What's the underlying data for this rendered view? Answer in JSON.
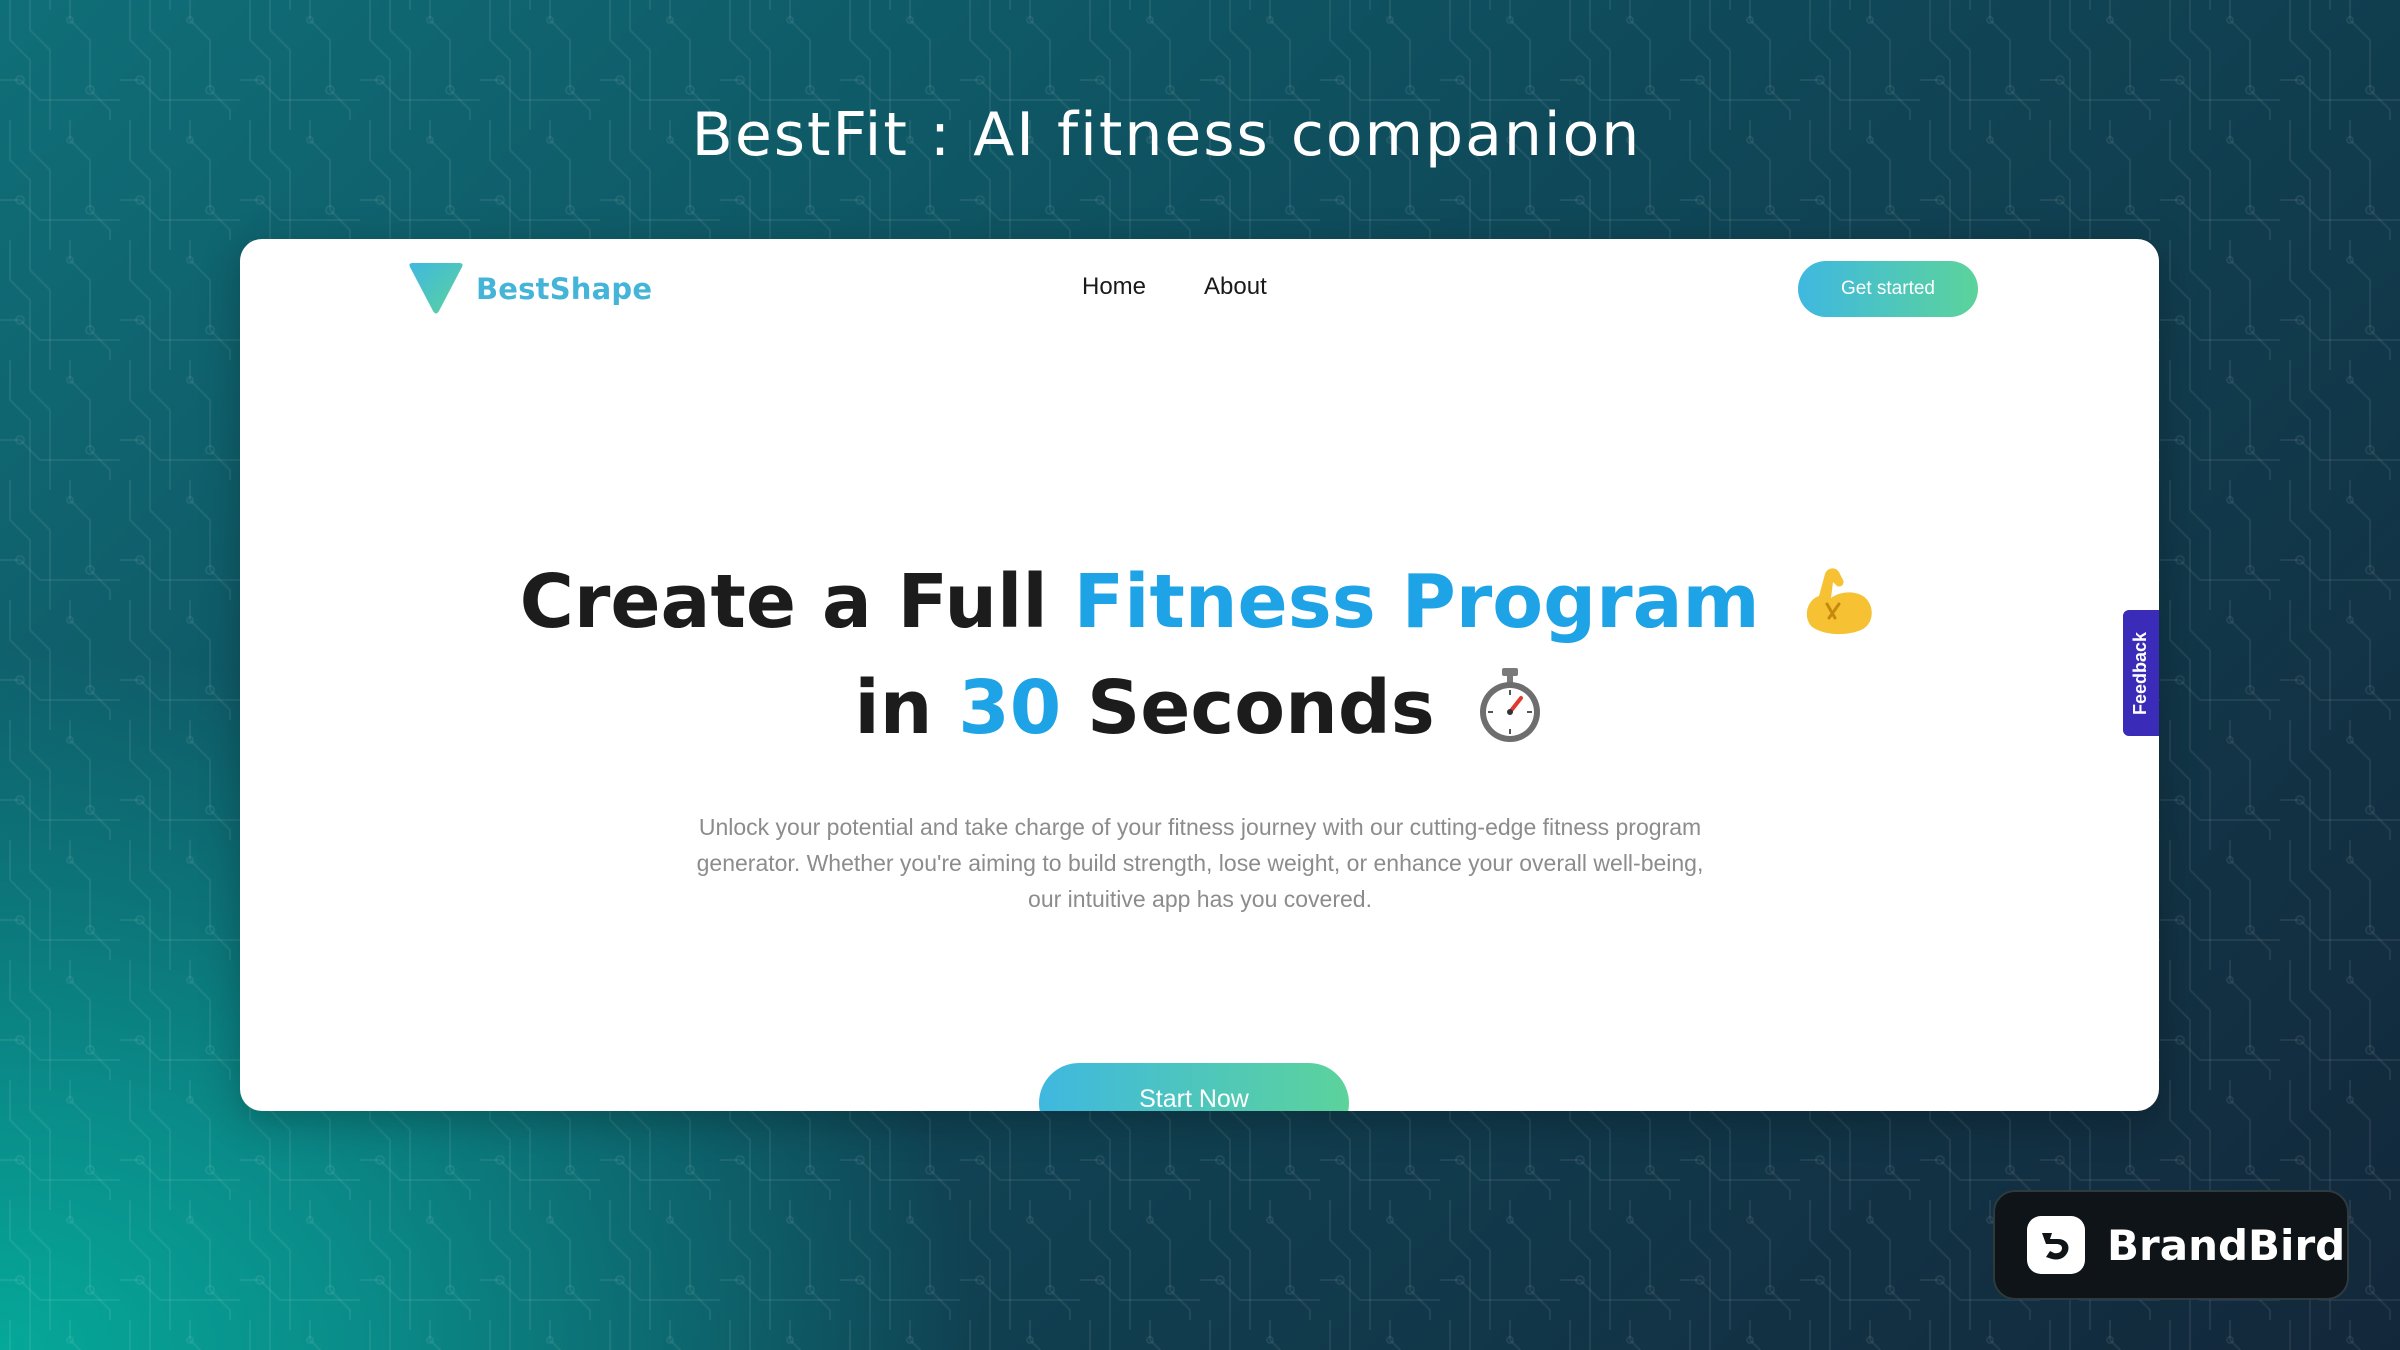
{
  "banner": {
    "title": "BestFit : AI fitness companion"
  },
  "site": {
    "logo_text": "BestShape",
    "nav": [
      {
        "label": "Home"
      },
      {
        "label": "About"
      }
    ],
    "cta_label": "Get started"
  },
  "hero": {
    "line1_prefix": "Create a Full ",
    "line1_accent": "Fitness Program",
    "line2_prefix": "in ",
    "line2_accent": "30",
    "line2_suffix": " Seconds",
    "description": "Unlock your potential and take charge of your fitness journey with our cutting-edge fitness program generator. Whether you're aiming to build strength, lose weight, or enhance your overall well-being, our intuitive app has you covered.",
    "start_button": "Start Now",
    "emoji_1": "flexed-biceps-icon",
    "emoji_2": "stopwatch-icon"
  },
  "feedback_tab": "Feedback",
  "watermark": {
    "brand": "BrandBird"
  },
  "colors": {
    "accent_blue": "#1ea3e6",
    "gradient_start": "#3fb8e0",
    "gradient_end": "#5cd39b",
    "feedback_bg": "#3a2bb8"
  }
}
